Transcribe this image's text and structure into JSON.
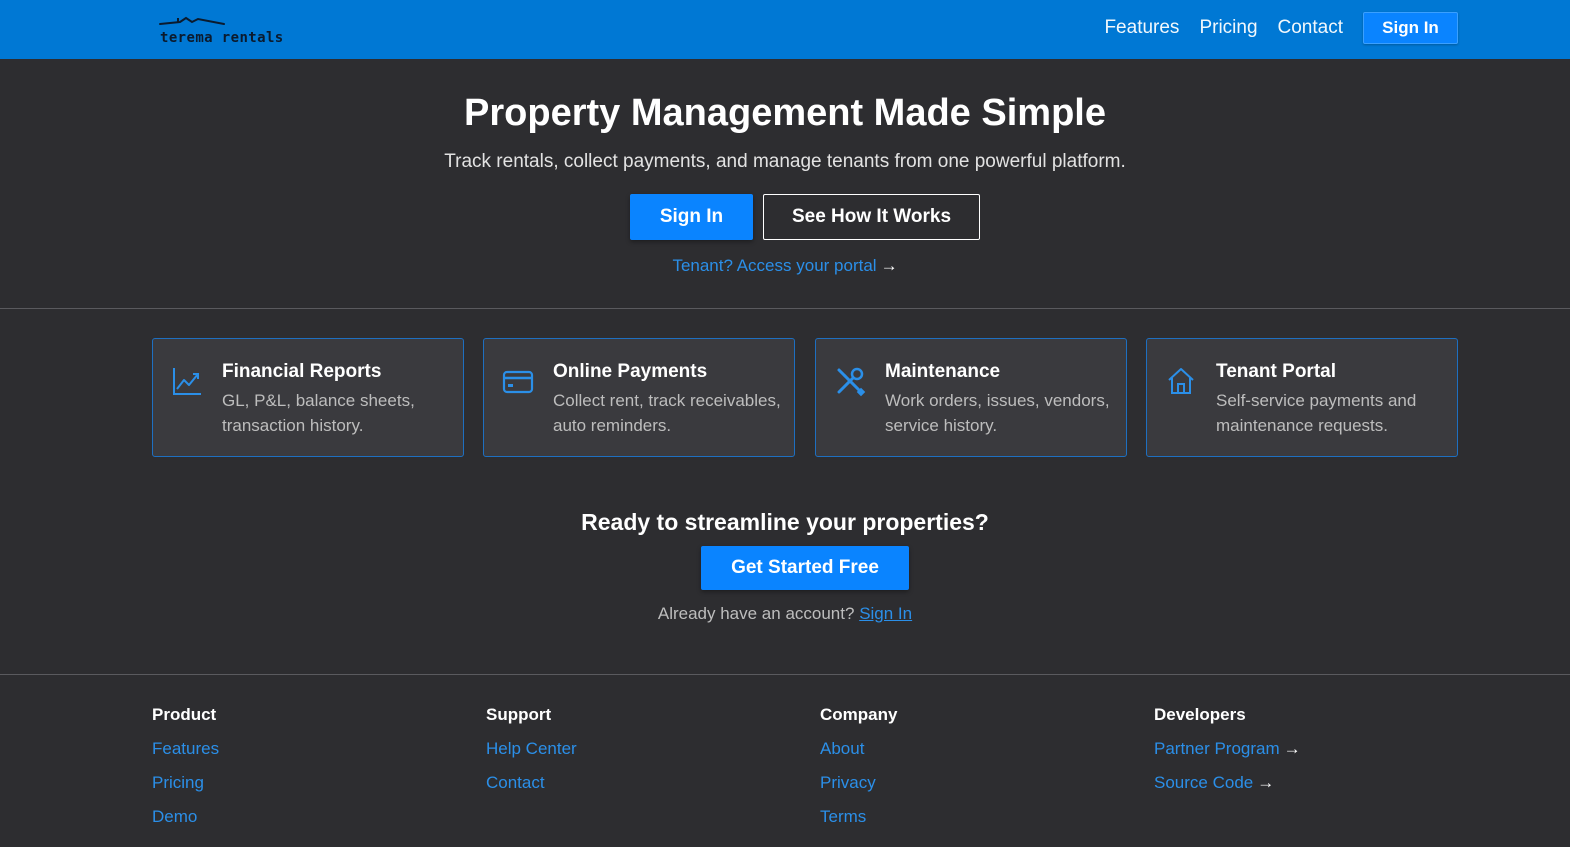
{
  "brand": {
    "name": "terema rentals"
  },
  "nav": {
    "links": [
      "Features",
      "Pricing",
      "Contact"
    ],
    "signin_label": "Sign In"
  },
  "hero": {
    "title": "Property Management Made Simple",
    "subtitle": "Track rentals, collect payments, and manage tenants from one powerful platform.",
    "primary_label": "Sign In",
    "secondary_label": "See How It Works",
    "tenant_link": "Tenant? Access your portal",
    "arrow": "→"
  },
  "features": [
    {
      "icon": "chart-line-icon",
      "title": "Financial Reports",
      "desc": "GL, P&L, balance sheets, transaction history."
    },
    {
      "icon": "credit-card-icon",
      "title": "Online Payments",
      "desc": "Collect rent, track receivables, auto reminders."
    },
    {
      "icon": "tools-icon",
      "title": "Maintenance",
      "desc": "Work orders, issues, vendors, service history."
    },
    {
      "icon": "house-icon",
      "title": "Tenant Portal",
      "desc": "Self-service payments and maintenance requests."
    }
  ],
  "cta": {
    "title": "Ready to streamline your properties?",
    "button_label": "Get Started Free",
    "account_text": "Already have an account?",
    "signin_link": "Sign In"
  },
  "footer": {
    "product": {
      "heading": "Product",
      "links": [
        "Features",
        "Pricing",
        "Demo"
      ]
    },
    "support": {
      "heading": "Support",
      "links": [
        "Help Center",
        "Contact"
      ]
    },
    "company": {
      "heading": "Company",
      "links": [
        "About",
        "Privacy",
        "Terms"
      ]
    },
    "developers": {
      "heading": "Developers",
      "links": [
        "Partner Program",
        "Source Code"
      ]
    },
    "arrow": "→"
  },
  "colors": {
    "header_bg": "#0078d4",
    "page_bg": "#2d2d30",
    "accent": "#0a84ff",
    "link": "#2b8fe8",
    "card_bg": "#3a3a3e",
    "card_border": "#1e6fc0"
  }
}
